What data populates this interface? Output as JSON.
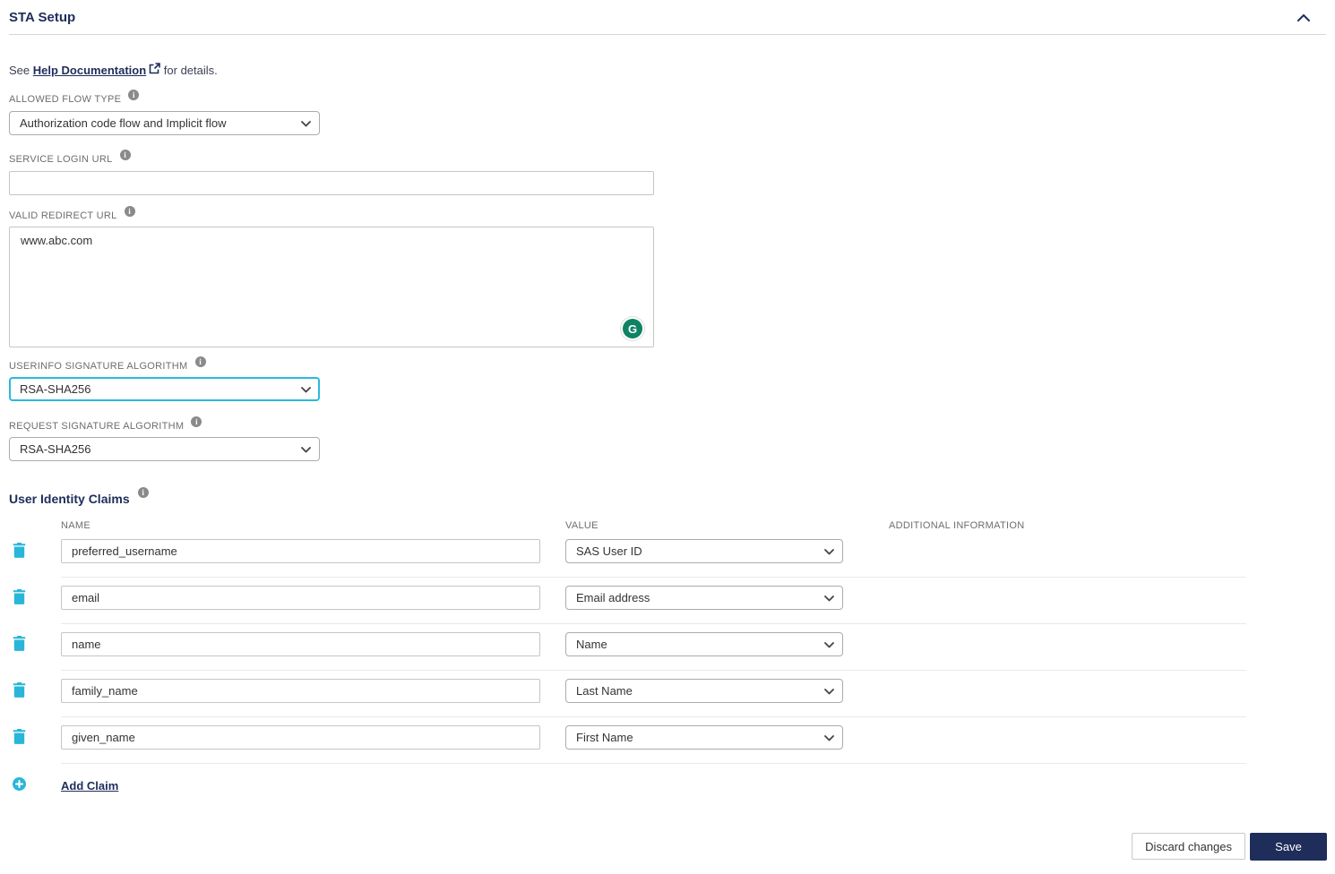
{
  "panel": {
    "title": "STA Setup",
    "help_prefix": "See",
    "help_link_label": "Help Documentation",
    "help_suffix": "for details."
  },
  "fields": {
    "allowed_flow_type": {
      "label": "ALLOWED FLOW TYPE",
      "value": "Authorization code flow and Implicit flow"
    },
    "service_login_url": {
      "label": "SERVICE LOGIN URL",
      "value": ""
    },
    "valid_redirect_url": {
      "label": "VALID REDIRECT URL",
      "value": "www.abc.com"
    },
    "userinfo_signature_algorithm": {
      "label": "USERINFO SIGNATURE ALGORITHM",
      "value": "RSA-SHA256"
    },
    "request_signature_algorithm": {
      "label": "REQUEST SIGNATURE ALGORITHM",
      "value": "RSA-SHA256"
    }
  },
  "claims": {
    "heading": "User Identity Claims",
    "columns": {
      "name": "NAME",
      "value": "VALUE",
      "additional": "ADDITIONAL INFORMATION"
    },
    "rows": [
      {
        "name": "preferred_username",
        "value": "SAS User ID"
      },
      {
        "name": "email",
        "value": "Email address"
      },
      {
        "name": "name",
        "value": "Name"
      },
      {
        "name": "family_name",
        "value": "Last Name"
      },
      {
        "name": "given_name",
        "value": "First Name"
      }
    ],
    "add_label": "Add Claim"
  },
  "footer": {
    "discard_label": "Discard changes",
    "save_label": "Save"
  },
  "icons": {
    "grammarly": "G",
    "collapse": "chevron-up",
    "delete": "trash",
    "add": "plus-circle",
    "help": "external-link",
    "info": "info-circle"
  },
  "colors": {
    "navy": "#1e2d5a",
    "accent_cyan": "#29b6d8",
    "focus_border": "#2ab9da",
    "grammarly_green": "#0e8364",
    "label_gray": "#6e6e6e"
  }
}
